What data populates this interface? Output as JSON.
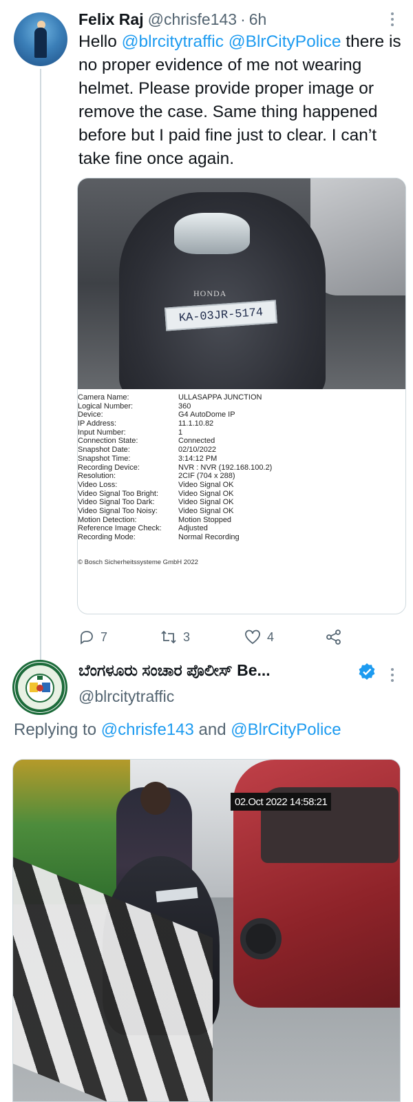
{
  "tweet1": {
    "display_name": "Felix Raj",
    "handle": "@chrisfe143",
    "separator": "·",
    "time": "6h",
    "text_prefix": "Hello ",
    "mention1": "@blrcitytraffic",
    "mention_space": " ",
    "mention2": "@BlrCityPolice",
    "text_body": " there is no proper evidence of me not wearing helmet.  Please provide proper image or remove the case.   Same thing happened before but I paid fine just to clear. I can’t take fine once again.",
    "photo": {
      "brand": "HONDA",
      "plate": "KA-03JR-5174",
      "metadata": [
        {
          "key": "Camera Name:",
          "value": "ULLASAPPA JUNCTION"
        },
        {
          "key": "Logical Number:",
          "value": "360"
        },
        {
          "key": "Device:",
          "value": "G4 AutoDome IP"
        },
        {
          "key": "IP Address:",
          "value": "11.1.10.82"
        },
        {
          "key": "Input Number:",
          "value": "1"
        },
        {
          "key": "Connection State:",
          "value": "Connected"
        },
        {
          "key": "Snapshot Date:",
          "value": "02/10/2022"
        },
        {
          "key": "Snapshot Time:",
          "value": "3:14:12 PM"
        },
        {
          "key": "Recording Device:",
          "value": "NVR : NVR (192.168.100.2)"
        },
        {
          "key": "Resolution:",
          "value": "2CIF (704 x 288)"
        },
        {
          "key": "Video Loss:",
          "value": "Video Signal OK"
        },
        {
          "key": "Video Signal Too Bright:",
          "value": "Video Signal OK"
        },
        {
          "key": "Video Signal Too Dark:",
          "value": "Video Signal OK"
        },
        {
          "key": "Video Signal Too Noisy:",
          "value": "Video Signal OK"
        },
        {
          "key": "Motion Detection:",
          "value": "Motion Stopped"
        },
        {
          "key": "Reference Image Check:",
          "value": "Adjusted"
        },
        {
          "key": "Recording Mode:",
          "value": "Normal Recording"
        }
      ],
      "copyright": "© Bosch Sicherheitssysteme GmbH 2022"
    },
    "actions": {
      "replies": "7",
      "retweets": "3",
      "likes": "4"
    }
  },
  "tweet2": {
    "display_name": "ಬೆಂಗಳೂರು ಸಂಚಾರ ಪೊಲೀಸ್ Be...",
    "handle": "@blrcitytraffic",
    "replying_prefix": "Replying to ",
    "replying_to1": "@chrisfe143",
    "replying_and": " and ",
    "replying_to2": "@BlrCityPolice",
    "photo": {
      "timestamp": "02.Oct 2022  14:58:21"
    }
  },
  "colors": {
    "link": "#1d9bf0",
    "secondary_text": "#536471",
    "verified": "#1d9bf0"
  },
  "icons": [
    "reply-icon",
    "retweet-icon",
    "like-icon",
    "share-icon",
    "verified-badge-icon",
    "more-icon"
  ]
}
